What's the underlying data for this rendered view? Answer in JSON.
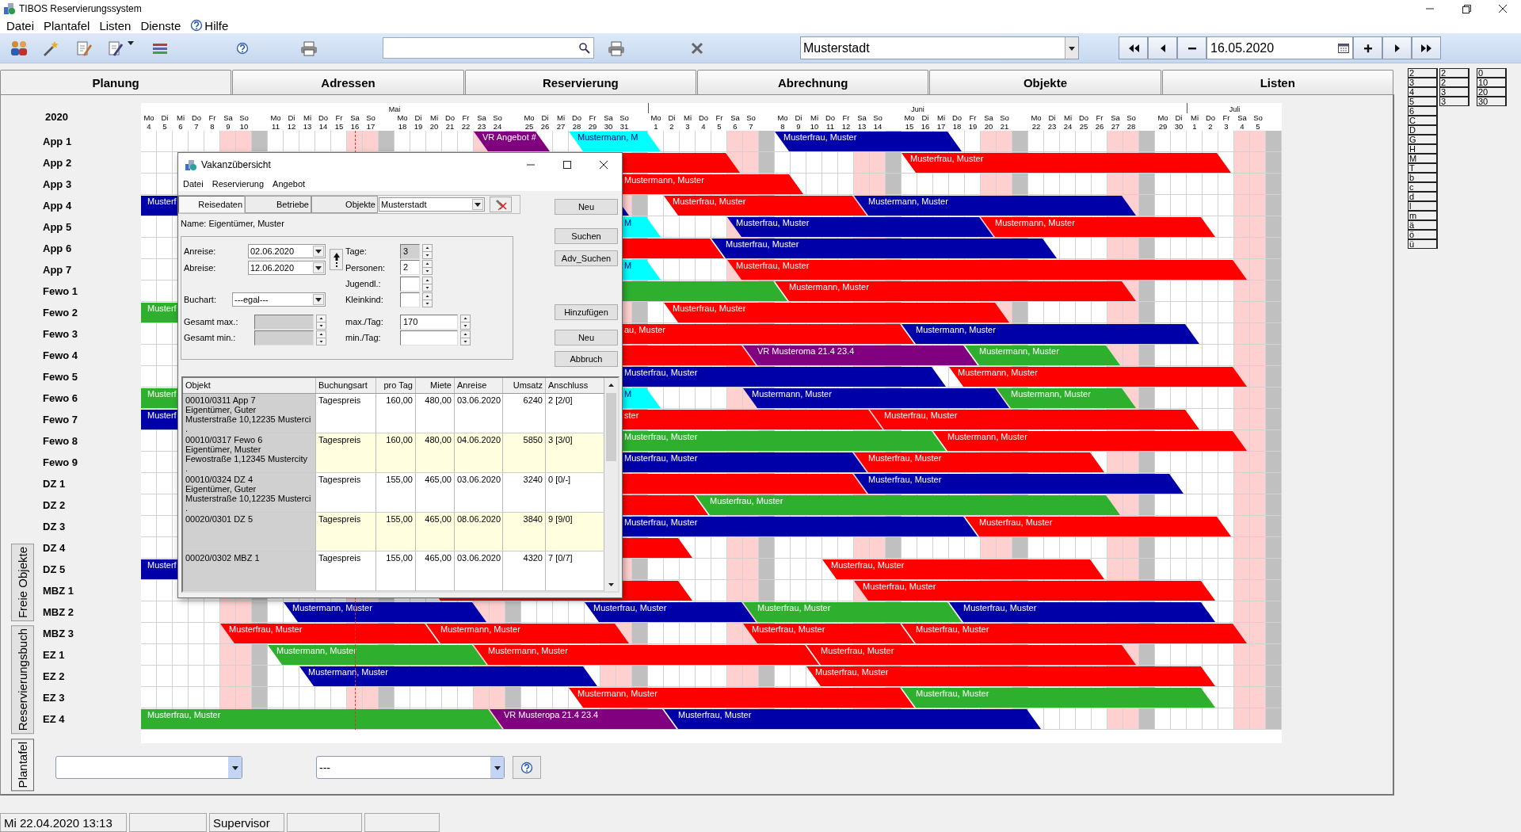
{
  "window": {
    "title": "TIBOS Reservierungssystem"
  },
  "menu": [
    {
      "label": "Datei",
      "kind": "plain"
    },
    {
      "label": "Plantafel",
      "kind": "plain"
    },
    {
      "label": "Listen",
      "kind": "plain"
    },
    {
      "label": "Dienste",
      "kind": "plain"
    },
    {
      "label": "Hilfe",
      "kind": "help"
    }
  ],
  "toolbar": {
    "location": "Musterstadt",
    "date": "16.05.2020"
  },
  "tabs": [
    {
      "label": "Planung",
      "selected": true
    },
    {
      "label": "Adressen",
      "selected": false
    },
    {
      "label": "Reservierung",
      "selected": false
    },
    {
      "label": "Abrechnung",
      "selected": false
    },
    {
      "label": "Objekte",
      "selected": false
    },
    {
      "label": "Listen",
      "selected": false
    }
  ],
  "side_tabs": [
    {
      "label": "Freie Objekte",
      "selected": false
    },
    {
      "label": "Reservierungsbuch",
      "selected": false
    },
    {
      "label": "Plantafel",
      "selected": true
    }
  ],
  "planner": {
    "year": "2020",
    "months": [
      {
        "label": "Mai",
        "days": [
          {
            "wd": "Mo",
            "d": "4",
            "kind": "workday",
            "today": false
          },
          {
            "wd": "Di",
            "d": "5",
            "kind": "workday",
            "today": false
          },
          {
            "wd": "Mi",
            "d": "6",
            "kind": "workday",
            "today": false
          },
          {
            "wd": "Do",
            "d": "7",
            "kind": "workday",
            "today": false
          },
          {
            "wd": "Fr",
            "d": "8",
            "kind": "workday",
            "today": false
          },
          {
            "wd": "Sa",
            "d": "9",
            "kind": "weekend",
            "today": false
          },
          {
            "wd": "So",
            "d": "10",
            "kind": "weekend",
            "today": false
          },
          {
            "wd": "Mo",
            "d": "11",
            "kind": "workday",
            "today": false
          },
          {
            "wd": "Di",
            "d": "12",
            "kind": "workday",
            "today": false
          },
          {
            "wd": "Mi",
            "d": "13",
            "kind": "workday",
            "today": false
          },
          {
            "wd": "Do",
            "d": "14",
            "kind": "workday",
            "today": false
          },
          {
            "wd": "Fr",
            "d": "15",
            "kind": "workday",
            "today": false
          },
          {
            "wd": "Sa",
            "d": "16",
            "kind": "weekend",
            "today": true
          },
          {
            "wd": "So",
            "d": "17",
            "kind": "weekend",
            "today": false
          },
          {
            "wd": "Mo",
            "d": "18",
            "kind": "workday",
            "today": false
          },
          {
            "wd": "Di",
            "d": "19",
            "kind": "workday",
            "today": false
          },
          {
            "wd": "Mi",
            "d": "20",
            "kind": "workday",
            "today": false
          },
          {
            "wd": "Do",
            "d": "21",
            "kind": "workday",
            "today": false
          },
          {
            "wd": "Fr",
            "d": "22",
            "kind": "workday",
            "today": false
          },
          {
            "wd": "Sa",
            "d": "23",
            "kind": "weekend",
            "today": false
          },
          {
            "wd": "So",
            "d": "24",
            "kind": "weekend",
            "today": false
          },
          {
            "wd": "Mo",
            "d": "25",
            "kind": "workday",
            "today": false
          },
          {
            "wd": "Di",
            "d": "26",
            "kind": "workday",
            "today": false
          },
          {
            "wd": "Mi",
            "d": "27",
            "kind": "workday",
            "today": false
          },
          {
            "wd": "Do",
            "d": "28",
            "kind": "workday",
            "today": false
          },
          {
            "wd": "Fr",
            "d": "29",
            "kind": "workday",
            "today": false
          },
          {
            "wd": "Sa",
            "d": "30",
            "kind": "weekend",
            "today": false
          },
          {
            "wd": "So",
            "d": "31",
            "kind": "weekend",
            "today": false
          }
        ]
      },
      {
        "label": "Juni",
        "days": [
          {
            "wd": "Mo",
            "d": "1",
            "kind": "workday",
            "today": false
          },
          {
            "wd": "Di",
            "d": "2",
            "kind": "workday",
            "today": false
          },
          {
            "wd": "Mi",
            "d": "3",
            "kind": "workday",
            "today": false
          },
          {
            "wd": "Do",
            "d": "4",
            "kind": "workday",
            "today": false
          },
          {
            "wd": "Fr",
            "d": "5",
            "kind": "workday",
            "today": false
          },
          {
            "wd": "Sa",
            "d": "6",
            "kind": "weekend",
            "today": false
          },
          {
            "wd": "So",
            "d": "7",
            "kind": "weekend",
            "today": false
          },
          {
            "wd": "Mo",
            "d": "8",
            "kind": "workday",
            "today": false
          },
          {
            "wd": "Di",
            "d": "9",
            "kind": "workday",
            "today": false
          },
          {
            "wd": "Mi",
            "d": "10",
            "kind": "workday",
            "today": false
          },
          {
            "wd": "Do",
            "d": "11",
            "kind": "workday",
            "today": false
          },
          {
            "wd": "Fr",
            "d": "12",
            "kind": "workday",
            "today": false
          },
          {
            "wd": "Sa",
            "d": "13",
            "kind": "weekend",
            "today": false
          },
          {
            "wd": "So",
            "d": "14",
            "kind": "weekend",
            "today": false
          },
          {
            "wd": "Mo",
            "d": "15",
            "kind": "workday",
            "today": false
          },
          {
            "wd": "Di",
            "d": "16",
            "kind": "workday",
            "today": false
          },
          {
            "wd": "Mi",
            "d": "17",
            "kind": "workday",
            "today": false
          },
          {
            "wd": "Do",
            "d": "18",
            "kind": "workday",
            "today": false
          },
          {
            "wd": "Fr",
            "d": "19",
            "kind": "workday",
            "today": false
          },
          {
            "wd": "Sa",
            "d": "20",
            "kind": "weekend",
            "today": false
          },
          {
            "wd": "So",
            "d": "21",
            "kind": "weekend",
            "today": false
          },
          {
            "wd": "Mo",
            "d": "22",
            "kind": "workday",
            "today": false
          },
          {
            "wd": "Di",
            "d": "23",
            "kind": "workday",
            "today": false
          },
          {
            "wd": "Mi",
            "d": "24",
            "kind": "workday",
            "today": false
          },
          {
            "wd": "Do",
            "d": "25",
            "kind": "workday",
            "today": false
          },
          {
            "wd": "Fr",
            "d": "26",
            "kind": "workday",
            "today": false
          },
          {
            "wd": "Sa",
            "d": "27",
            "kind": "weekend",
            "today": false
          },
          {
            "wd": "So",
            "d": "28",
            "kind": "weekend",
            "today": false
          },
          {
            "wd": "Mo",
            "d": "29",
            "kind": "workday",
            "today": false
          },
          {
            "wd": "Di",
            "d": "30",
            "kind": "workday",
            "today": false
          }
        ]
      },
      {
        "label": "Juli",
        "days": [
          {
            "wd": "Mi",
            "d": "1",
            "kind": "workday",
            "today": false
          },
          {
            "wd": "Do",
            "d": "2",
            "kind": "workday",
            "today": false
          },
          {
            "wd": "Fr",
            "d": "3",
            "kind": "workday",
            "today": false
          },
          {
            "wd": "Sa",
            "d": "4",
            "kind": "weekend",
            "today": false
          },
          {
            "wd": "So",
            "d": "5",
            "kind": "weekend",
            "today": false
          }
        ]
      }
    ],
    "rows": [
      {
        "label": "App 1",
        "bookings": [
          {
            "label": "VR Angebot #",
            "color": "#800080"
          },
          {
            "label": "Mustermann, M",
            "color": "#00ffff"
          },
          {
            "label": "Musterfrau, Muster",
            "color": "#0000a8"
          }
        ]
      },
      {
        "label": "App 2",
        "bookings": [
          {
            "color": "#ff0000"
          },
          {
            "label": "Musterfrau, Muster",
            "color": "#ff0000"
          }
        ]
      },
      {
        "label": "App 3",
        "bookings": [
          {
            "label": "Mustermann, Muster",
            "color": "#ff0000"
          }
        ]
      },
      {
        "label": "App 4",
        "bookings": [
          {
            "label": "Musterf",
            "color": "#0000a8"
          },
          {
            "label": "Musterfrau, Muster",
            "color": "#ff0000"
          },
          {
            "label": "Mustermann, Muster",
            "color": "#0000a8"
          }
        ]
      },
      {
        "label": "App 5",
        "bookings": [
          {
            "label": "M",
            "color": "#00ffff"
          },
          {
            "label": "Musterfrau, Muster",
            "color": "#0000a8"
          },
          {
            "label": "Mustermann, Muster",
            "color": "#ff0000"
          }
        ]
      },
      {
        "label": "App 6",
        "bookings": [
          {
            "color": "#ff0000"
          },
          {
            "label": "Musterfrau, Muster",
            "color": "#0000a8"
          }
        ]
      },
      {
        "label": "App 7",
        "bookings": [
          {
            "label": "M",
            "color": "#00ffff"
          },
          {
            "label": "Musterfrau, Muster",
            "color": "#ff0000"
          }
        ]
      },
      {
        "label": "Fewo 1",
        "bookings": [
          {
            "color": "#2eb02e"
          },
          {
            "label": "Mustermann, Muster",
            "color": "#ff0000"
          }
        ]
      },
      {
        "label": "Fewo 2",
        "bookings": [
          {
            "label": "Musterf",
            "color": "#2eb02e"
          },
          {
            "label": "Musterfrau, Muster",
            "color": "#ff0000"
          }
        ]
      },
      {
        "label": "Fewo 3",
        "bookings": [
          {
            "label": "au, Muster",
            "color": "#ff0000"
          },
          {
            "label": "Mustermann, Muster",
            "color": "#0000a8"
          }
        ]
      },
      {
        "label": "Fewo 4",
        "bookings": [
          {
            "color": "#ff0000"
          },
          {
            "label": "VR Musteroma 21.4 23.4",
            "color": "#800080"
          },
          {
            "label": "Mustermann, Muster",
            "color": "#2eb02e"
          }
        ]
      },
      {
        "label": "Fewo 5",
        "bookings": [
          {
            "label": "Musterfrau, Muster",
            "color": "#0000a8"
          },
          {
            "label": "Mustermann, Muster",
            "color": "#ff0000"
          }
        ]
      },
      {
        "label": "Fewo 6",
        "bookings": [
          {
            "label": "Musterf",
            "color": "#2eb02e"
          },
          {
            "label": "M",
            "color": "#00ffff"
          },
          {
            "label": "Mustermann, Muster",
            "color": "#0000a8"
          },
          {
            "label": "Mustermann, Muster",
            "color": "#2eb02e"
          }
        ]
      },
      {
        "label": "Fewo 7",
        "bookings": [
          {
            "label": "Musterf",
            "color": "#0000a8"
          },
          {
            "label": "ster",
            "color": "#ff0000"
          },
          {
            "label": "Musterfrau, Muster",
            "color": "#ff0000"
          }
        ]
      },
      {
        "label": "Fewo 8",
        "bookings": [
          {
            "label": "Musterfrau, Muster",
            "color": "#2eb02e"
          },
          {
            "label": "Mustermann, Muster",
            "color": "#ff0000"
          }
        ]
      },
      {
        "label": "Fewo 9",
        "bookings": [
          {
            "label": "Musterfrau, Muster",
            "color": "#0000a8"
          },
          {
            "label": "Musterfrau, Muster",
            "color": "#ff0000"
          }
        ]
      },
      {
        "label": "DZ 1",
        "bookings": [
          {
            "color": "#ff0000"
          },
          {
            "label": "Musterfrau, Muster",
            "color": "#0000a8"
          }
        ]
      },
      {
        "label": "DZ 2",
        "bookings": [
          {
            "color": "#ff0000"
          },
          {
            "label": "Musterfrau, Muster",
            "color": "#2eb02e"
          }
        ]
      },
      {
        "label": "DZ 3",
        "bookings": [
          {
            "label": "Musterfrau, Muster",
            "color": "#0000a8"
          },
          {
            "label": "Musterfrau, Muster",
            "color": "#ff0000"
          }
        ]
      },
      {
        "label": "DZ 4",
        "bookings": [
          {
            "color": "#ff0000"
          }
        ]
      },
      {
        "label": "DZ 5",
        "bookings": [
          {
            "label": "Musterf",
            "color": "#0000a8"
          },
          {
            "label": "Musterfrau, Muster",
            "color": "#ff0000"
          }
        ]
      },
      {
        "label": "MBZ 1",
        "bookings": [
          {
            "color": "#ff0000"
          },
          {
            "label": "Musterfrau, Muster",
            "color": "#ff0000"
          }
        ]
      },
      {
        "label": "MBZ 2",
        "bookings": [
          {
            "label": "Mustermann, Muster",
            "color": "#0000a8"
          },
          {
            "label": "Musterfrau, Muster",
            "color": "#0000a8"
          },
          {
            "label": "Musterfrau, Muster",
            "color": "#2eb02e"
          },
          {
            "label": "Musterfrau, Muster",
            "color": "#0000a8"
          }
        ]
      },
      {
        "label": "MBZ 3",
        "bookings": [
          {
            "label": "Musterfrau, Muster",
            "color": "#ff0000"
          },
          {
            "label": "Mustermann, Muster",
            "color": "#ff0000"
          },
          {
            "label": "Musterfrau, Muster",
            "color": "#ff0000"
          },
          {
            "label": "Musterfrau, Muster",
            "color": "#ff0000"
          }
        ]
      },
      {
        "label": "EZ 1",
        "bookings": [
          {
            "label": "Mustermann, Muster",
            "color": "#2eb02e"
          },
          {
            "label": "Mustermann, Muster",
            "color": "#ff0000"
          },
          {
            "label": "Musterfrau, Muster",
            "color": "#ff0000"
          }
        ]
      },
      {
        "label": "EZ 2",
        "bookings": [
          {
            "label": "Mustermann, Muster",
            "color": "#0000a8"
          },
          {
            "label": "Musterfrau, Muster",
            "color": "#ff0000"
          }
        ]
      },
      {
        "label": "EZ 3",
        "bookings": [
          {
            "label": "Mustermann, Muster",
            "color": "#ff0000"
          },
          {
            "label": "Musterfrau, Muster",
            "color": "#2eb02e"
          }
        ]
      },
      {
        "label": "EZ 4",
        "bookings": [
          {
            "label": "Musterfrau, Muster",
            "color": "#2eb02e"
          },
          {
            "label": "VR Musteropa 21.4 23.4",
            "color": "#800080"
          },
          {
            "label": "Musterfrau, Muster",
            "color": "#0000a8"
          }
        ]
      }
    ]
  },
  "filter_select": {
    "value": "---"
  },
  "legend": [
    [
      "2",
      "3",
      "4",
      "5",
      "6",
      "C",
      "D",
      "G",
      "H",
      "M",
      "T",
      "b",
      "c",
      "d",
      "l",
      "m",
      "ä",
      "ö",
      "ü"
    ],
    [
      "2",
      "2",
      "3",
      "3"
    ],
    [
      "0",
      "10",
      "20",
      "30"
    ]
  ],
  "status_bar": {
    "datetime": "Mi 22.04.2020 13:13",
    "user": "Supervisor"
  },
  "dialog": {
    "title": "Vakanzübersicht",
    "menu": [
      "Datei",
      "Reservierung",
      "Angebot"
    ],
    "tabs": [
      {
        "label": "Reisedaten",
        "selected": true
      },
      {
        "label": "Betriebe",
        "selected": false
      },
      {
        "label": "Objekte",
        "selected": false
      }
    ],
    "location": "Musterstadt",
    "name_line": "Name: Eigentümer, Muster",
    "form": {
      "arrival": {
        "label": "Anreise:",
        "value": "02.06.2020"
      },
      "departure": {
        "label": "Abreise:",
        "value": "12.06.2020"
      },
      "booking_type": {
        "label": "Buchart:",
        "value": "---egal---"
      },
      "total_max": {
        "label": "Gesamt max.:",
        "disabled": true
      },
      "total_min": {
        "label": "Gesamt min.:",
        "disabled": true
      },
      "days": {
        "label": "Tage:",
        "value": "3",
        "disabled": true
      },
      "persons": {
        "label": "Personen:",
        "value": "2",
        "disabled": false
      },
      "youths": {
        "label": "Jugendl.:",
        "disabled": false
      },
      "infants": {
        "label": "Kleinkind:",
        "disabled": false
      },
      "max_per_day": {
        "label": "max./Tag:",
        "value": "170",
        "disabled": false
      },
      "min_per_day": {
        "label": "min./Tag:",
        "disabled": false
      }
    },
    "buttons": [
      "Neu",
      "Suchen",
      "Adv_Suchen",
      "Hinzufügen",
      "Neu",
      "Abbruch"
    ],
    "results": {
      "columns": [
        "Objekt",
        "Buchungsart",
        "pro Tag",
        "Miete",
        "Anreise",
        "Umsatz",
        "Anschluss"
      ],
      "rows": [
        {
          "cells": [
            "00010/0311 App 7\nEigentümer, Guter\nMusterstraße 10,12235 Musterci\n.",
            "Tagespreis",
            "160,00",
            "480,00",
            "03.06.2020",
            "6240",
            "2 [2/0]"
          ],
          "shaded": false
        },
        {
          "cells": [
            "00010/0317 Fewo 6\nEigentümer, Muster\nFewostraße 1,12345 Mustercity\n.",
            "Tagespreis",
            "160,00",
            "480,00",
            "04.06.2020",
            "5850",
            "3 [3/0]"
          ],
          "shaded": true
        },
        {
          "cells": [
            "00010/0324 DZ 4\nEigentümer, Guter\nMusterstraße 10,12235 Musterci\n.",
            "Tagespreis",
            "155,00",
            "465,00",
            "03.06.2020",
            "3240",
            "0 [0/-]"
          ],
          "shaded": false
        },
        {
          "cells": [
            "00020/0301 DZ 5",
            "Tagespreis",
            "155,00",
            "465,00",
            "08.06.2020",
            "3840",
            "9 [9/0]"
          ],
          "shaded": true
        },
        {
          "cells": [
            "00020/0302 MBZ 1",
            "Tagespreis",
            "155,00",
            "465,00",
            "03.06.2020",
            "4320",
            "7 [0/7]"
          ],
          "shaded": false
        }
      ]
    }
  }
}
